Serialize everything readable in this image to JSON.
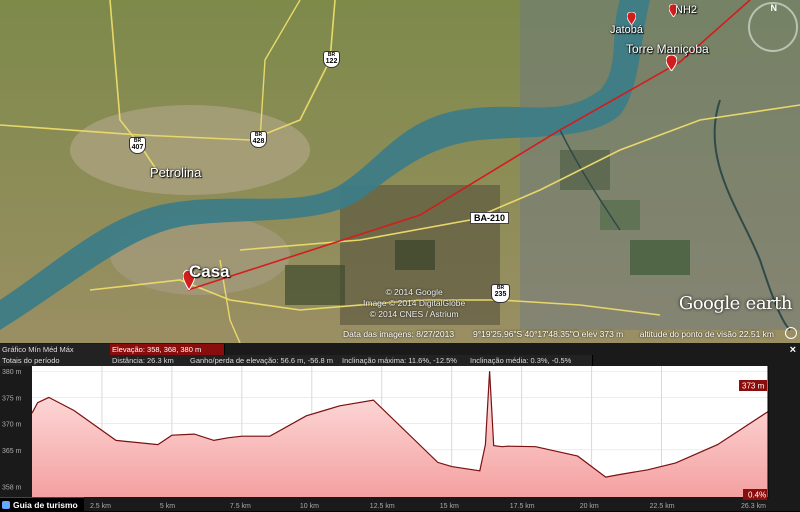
{
  "map": {
    "places": {
      "petrolina": "Petrolina",
      "casa": "Casa",
      "jatoba": "Jatobá",
      "torre": "Torre Maniçoba",
      "nh2": "NH2"
    },
    "roads": {
      "br407": {
        "top": "BR",
        "num": "407"
      },
      "br122": {
        "top": "BR",
        "num": "122"
      },
      "br428": {
        "top": "BR",
        "num": "428"
      },
      "br235": {
        "top": "BR",
        "num": "235"
      },
      "ba210": "BA-210"
    },
    "credits": [
      "© 2014 Google",
      "Image © 2014 DigitalGlobe",
      "© 2014 CNES / Astrium"
    ],
    "logo": {
      "google": "Google",
      "earth": "earth"
    },
    "compass": "N",
    "status": {
      "date": "Data das imagens: 8/27/2013",
      "coords": "9°19'25.96\"S   40°17'48.35\"O   elev   373 m",
      "eye": "altitude do ponto de visão   22.51 km"
    }
  },
  "profile": {
    "graph_label": "Gráfico  Mín   Méd  Máx",
    "elevation": "Elevação: 358, 368, 380 m",
    "totals": "Totais do período",
    "distance": "Distância: 26.3 km",
    "gain": "Ganho/perda de elevação: 56.6 m, -56.8 m",
    "max_slope": "Inclinação máxima: 11.6%, -12.5%",
    "avg_slope": "Inclinação média: 0.3%, -0.5%",
    "close": "×",
    "cursor_elev": "373 m",
    "cursor_slope": "0.4%",
    "guide": "Guia de turismo"
  },
  "chart_data": {
    "type": "area",
    "xlabel": "",
    "ylabel": "",
    "x_ticks": [
      "2.5 km",
      "5 km",
      "7.5 km",
      "10 km",
      "12.5 km",
      "15 km",
      "17.5 km",
      "20 km",
      "22.5 km",
      "26.3 km"
    ],
    "y_ticks": [
      "380 m",
      "375 m",
      "370 m",
      "365 m",
      "358 m"
    ],
    "x": [
      0,
      0.2,
      0.6,
      1.5,
      3.0,
      4.5,
      5.0,
      5.8,
      6.5,
      7.0,
      7.5,
      8.5,
      9.8,
      10.5,
      11.0,
      12.2,
      14.5,
      15.0,
      16.0,
      16.2,
      16.35,
      16.5,
      16.8,
      17.0,
      18.0,
      19.5,
      20.5,
      21.0,
      22.0,
      23.0,
      24.5,
      26.3
    ],
    "y": [
      372,
      374,
      375,
      372.5,
      366.8,
      366.0,
      367.8,
      368.0,
      366.8,
      367.3,
      367.6,
      367.6,
      371.5,
      372.6,
      373.4,
      374.5,
      362.6,
      361.8,
      361.0,
      366,
      380,
      365.8,
      365.6,
      365.7,
      365.6,
      363.8,
      359.8,
      360.3,
      361.2,
      362.5,
      366,
      372.3
    ],
    "ylim": [
      356,
      381
    ],
    "xlim": [
      0,
      26.3
    ],
    "grid": true
  },
  "colors": {
    "path": "#d21d1d",
    "fill_top": "#ffe2e2",
    "fill_bottom": "#f59a9a",
    "highlight": "#8a0d0d",
    "river": "#3d7c86"
  }
}
